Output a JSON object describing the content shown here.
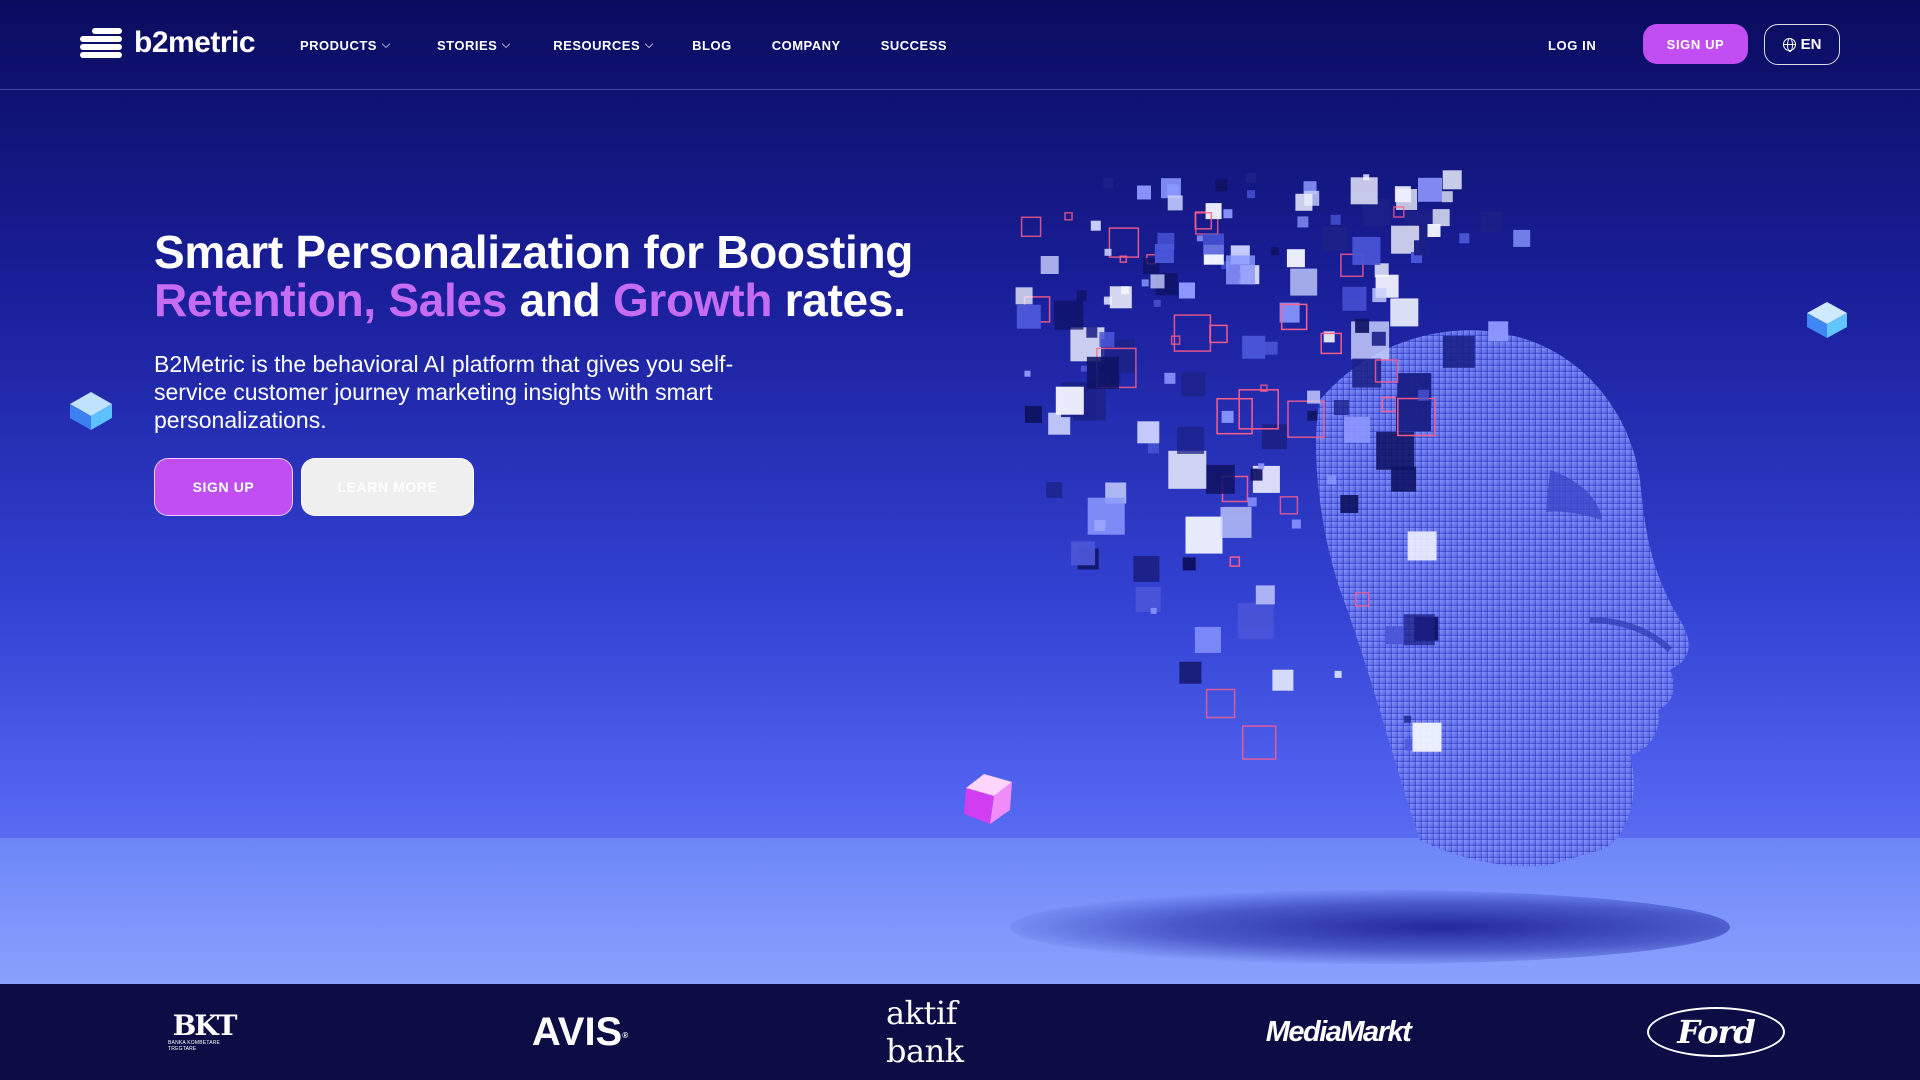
{
  "brand": {
    "name": "b2metric"
  },
  "nav": {
    "items": [
      {
        "label": "PRODUCTS",
        "has_dropdown": true
      },
      {
        "label": "STORIES",
        "has_dropdown": true
      },
      {
        "label": "RESOURCES",
        "has_dropdown": true
      },
      {
        "label": "BLOG",
        "has_dropdown": false
      },
      {
        "label": "COMPANY",
        "has_dropdown": false
      },
      {
        "label": "SUCCESS",
        "has_dropdown": false
      }
    ],
    "login_label": "LOG IN",
    "signup_label": "SIGN UP",
    "language_label": "EN"
  },
  "hero": {
    "headline_line1": "Smart Personalization for Boosting",
    "headline_word_retention": "Retention,",
    "headline_word_sales": "Sales",
    "headline_word_and": "and",
    "headline_word_growth": "Growth",
    "headline_word_rates": "rates.",
    "subtext": "B2Metric is the behavioral AI platform that gives you self-service customer journey marketing insights with smart personalizations.",
    "signup_label": "SIGN UP",
    "learn_more_label": "LEARN MORE"
  },
  "client_logos": {
    "bkt": "BKT",
    "bkt_tagline": "BANKA KOMBETARE TREGTARE",
    "avis": "AVIS",
    "avis_mark": "®",
    "aktifbank": "aktif bank",
    "mediamarkt": "MediaMarkt",
    "ford": "Ford"
  },
  "colors": {
    "accent_purple": "#c04ef2",
    "accent_text": "#c56cf3",
    "header_bg": "#0a0c5e",
    "logo_strip_bg": "#0b0d44"
  },
  "icons": {
    "logo_mark": "b2metric-logo-icon",
    "globe": "globe-icon",
    "dropdown": "chevron-down-icon",
    "hero_art": "pixelated-ai-head-illustration"
  }
}
